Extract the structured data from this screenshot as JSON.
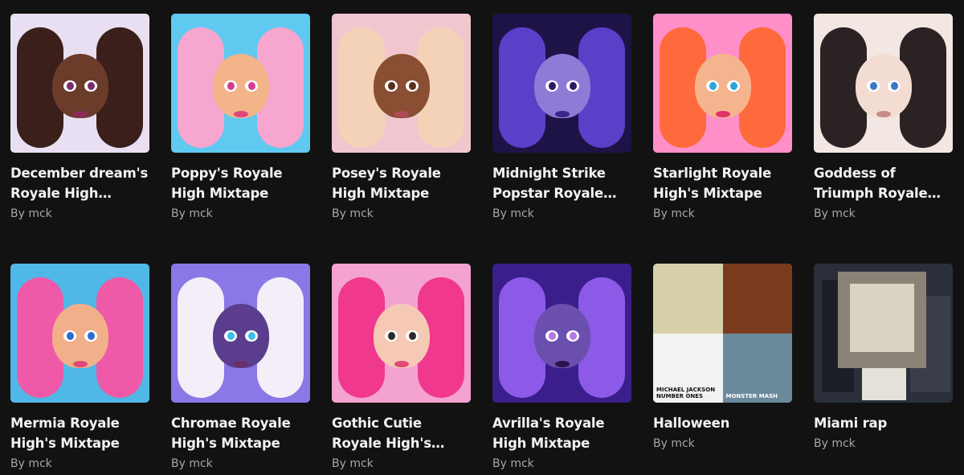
{
  "playlists": [
    {
      "title": "December dream's Royale High Record",
      "by": "By mck",
      "art": "december-dream-cover",
      "bg": "#e9dff2",
      "hair": "#3a1f1a",
      "skin": "#6b3c2a",
      "iris": "#7a2e6e",
      "lip": "#8e2a5a"
    },
    {
      "title": "Poppy's Royale High Mixtape",
      "by": "By mck",
      "art": "poppy-cover",
      "bg": "#5fc9f0",
      "hair": "#f7a6cf",
      "skin": "#f3b48a",
      "iris": "#d43d8f",
      "lip": "#e0457a"
    },
    {
      "title": "Posey's Royale High Mixtape",
      "by": "By mck",
      "art": "posey-cover",
      "bg": "#f2c6cf",
      "hair": "#f4d2b8",
      "skin": "#8a4e33",
      "iris": "#5a2e1e",
      "lip": "#b04a5a"
    },
    {
      "title": "Midnight Strike Popstar Royale…",
      "by": "By mck",
      "art": "midnight-strike-cover",
      "bg": "#1d1346",
      "hair": "#5b3fc8",
      "skin": "#8f7ad6",
      "iris": "#2a1a66",
      "lip": "#3c2488"
    },
    {
      "title": "Starlight Royale High's Mixtape",
      "by": "By mck",
      "art": "starlight-cover",
      "bg": "#ff8fc8",
      "hair": "#ff6a3c",
      "skin": "#f4b58e",
      "iris": "#2fa4d8",
      "lip": "#e0306a"
    },
    {
      "title": "Goddess of Triumph Royale…",
      "by": "By mck",
      "art": "goddess-of-triumph-cover",
      "bg": "#f3e7e3",
      "hair": "#2b2224",
      "skin": "#f3ddd2",
      "iris": "#3c78c8",
      "lip": "#c88a8a"
    },
    {
      "title": "Mermia Royale High's Mixtape",
      "by": "By mck",
      "art": "mermia-cover",
      "bg": "#4fb8e6",
      "hair": "#ee5aa8",
      "skin": "#f2b08a",
      "iris": "#2e6cd2",
      "lip": "#e04a7a"
    },
    {
      "title": "Chromae Royale High's Mixtape",
      "by": "By mck",
      "art": "chromae-cover",
      "bg": "#8a78e6",
      "hair": "#f3eef8",
      "skin": "#5a3d8c",
      "iris": "#3ac0f0",
      "lip": "#6a2e6a"
    },
    {
      "title": "Gothic Cutie Royale High's Mixtape",
      "by": "By mck",
      "art": "gothic-cutie-cover",
      "bg": "#f4a2cf",
      "hair": "#f0388e",
      "skin": "#f6c9b4",
      "iris": "#2a2a2a",
      "lip": "#e04a7a"
    },
    {
      "title": "Avrilla's Royale High Mixtape",
      "by": "By mck",
      "art": "avrilla-cover",
      "bg": "#3a1e8c",
      "hair": "#8c5ae6",
      "skin": "#6a4fae",
      "iris": "#b07ae6",
      "lip": "#2a1450"
    },
    {
      "title": "Halloween",
      "by": "By mck",
      "art": "halloween-collage-cover",
      "bg": "#d8c8b0"
    },
    {
      "title": "Miami rap",
      "by": "By mck",
      "art": "miami-rap-cover",
      "bg": "#2a2f3a"
    }
  ],
  "halloween_tiles": [
    {
      "text": "",
      "bg": "#d7cfa8"
    },
    {
      "text": "",
      "bg": "#7a3a1e"
    },
    {
      "text": "MICHAEL JACKSON NUMBER ONES",
      "bg": "#f2f2f2"
    },
    {
      "text": "MONSTER MASH",
      "bg": "#6a8a9c"
    }
  ]
}
